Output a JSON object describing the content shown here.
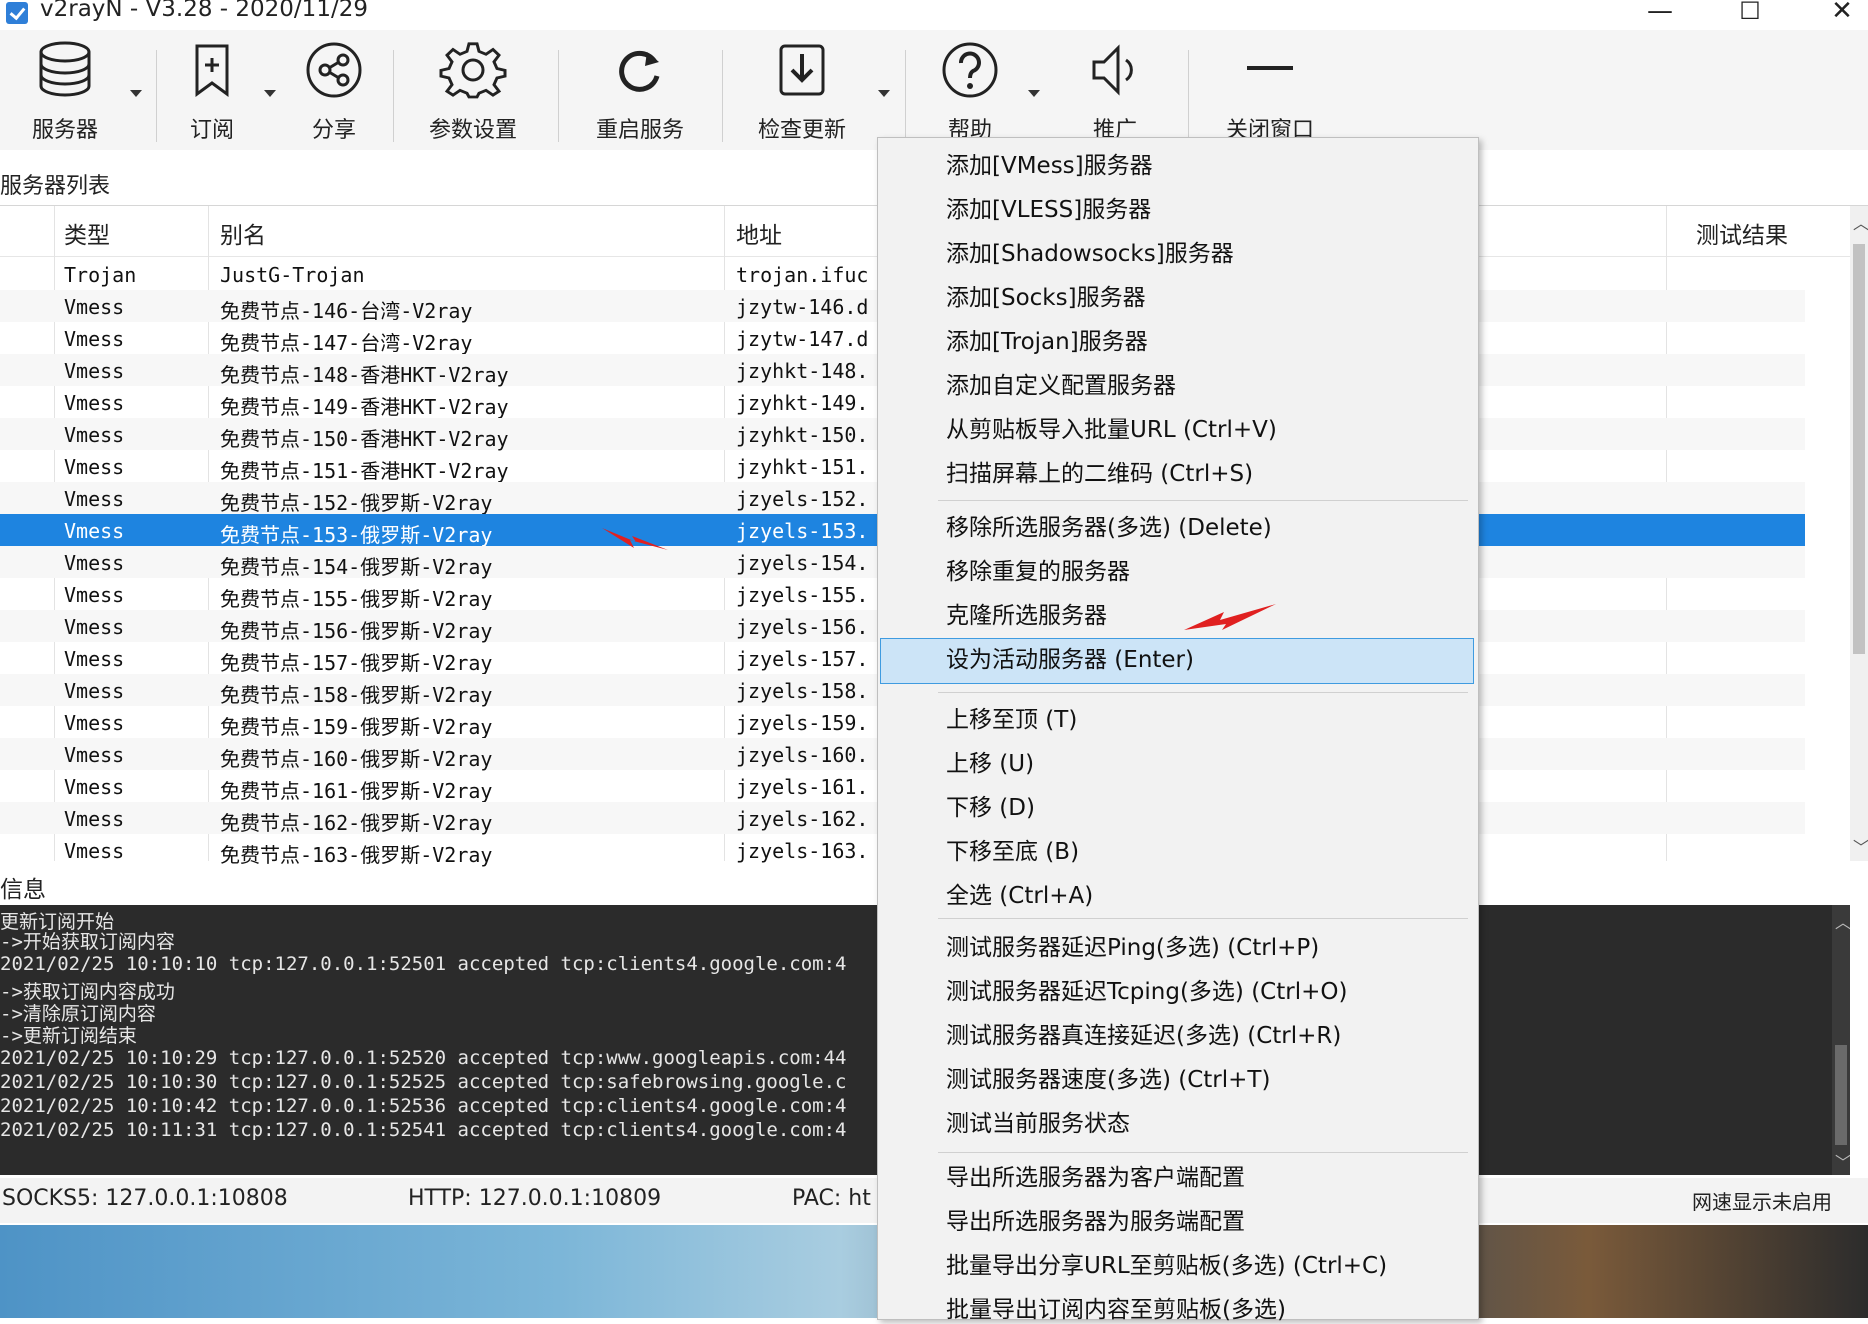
{
  "window": {
    "title": "v2rayN - V3.28 - 2020/11/29",
    "minimize": "—",
    "maximize": "☐",
    "close": "✕"
  },
  "toolbar": {
    "servers": "服务器",
    "subscribe": "订阅",
    "share": "分享",
    "settings": "参数设置",
    "restart": "重启服务",
    "update": "检查更新",
    "help": "帮助",
    "promote": "推广",
    "close_window": "关闭窗口"
  },
  "server_list": {
    "label": "服务器列表",
    "headers": {
      "type": "类型",
      "alias": "别名",
      "address": "地址",
      "test_result": "测试结果"
    },
    "rows": [
      {
        "type": "Trojan",
        "alias": "JustG-Trojan",
        "address": "trojan.ifuc"
      },
      {
        "type": "Vmess",
        "alias": "免费节点-146-台湾-V2ray",
        "address": "jzytw-146.d"
      },
      {
        "type": "Vmess",
        "alias": "免费节点-147-台湾-V2ray",
        "address": "jzytw-147.d"
      },
      {
        "type": "Vmess",
        "alias": "免费节点-148-香港HKT-V2ray",
        "address": "jzyhkt-148."
      },
      {
        "type": "Vmess",
        "alias": "免费节点-149-香港HKT-V2ray",
        "address": "jzyhkt-149."
      },
      {
        "type": "Vmess",
        "alias": "免费节点-150-香港HKT-V2ray",
        "address": "jzyhkt-150."
      },
      {
        "type": "Vmess",
        "alias": "免费节点-151-香港HKT-V2ray",
        "address": "jzyhkt-151."
      },
      {
        "type": "Vmess",
        "alias": "免费节点-152-俄罗斯-V2ray",
        "address": "jzyels-152."
      },
      {
        "type": "Vmess",
        "alias": "免费节点-153-俄罗斯-V2ray",
        "address": "jzyels-153."
      },
      {
        "type": "Vmess",
        "alias": "免费节点-154-俄罗斯-V2ray",
        "address": "jzyels-154."
      },
      {
        "type": "Vmess",
        "alias": "免费节点-155-俄罗斯-V2ray",
        "address": "jzyels-155."
      },
      {
        "type": "Vmess",
        "alias": "免费节点-156-俄罗斯-V2ray",
        "address": "jzyels-156."
      },
      {
        "type": "Vmess",
        "alias": "免费节点-157-俄罗斯-V2ray",
        "address": "jzyels-157."
      },
      {
        "type": "Vmess",
        "alias": "免费节点-158-俄罗斯-V2ray",
        "address": "jzyels-158."
      },
      {
        "type": "Vmess",
        "alias": "免费节点-159-俄罗斯-V2ray",
        "address": "jzyels-159."
      },
      {
        "type": "Vmess",
        "alias": "免费节点-160-俄罗斯-V2ray",
        "address": "jzyels-160."
      },
      {
        "type": "Vmess",
        "alias": "免费节点-161-俄罗斯-V2ray",
        "address": "jzyels-161."
      },
      {
        "type": "Vmess",
        "alias": "免费节点-162-俄罗斯-V2ray",
        "address": "jzyels-162."
      },
      {
        "type": "Vmess",
        "alias": "免费节点-163-俄罗斯-V2ray",
        "address": "jzyels-163."
      }
    ]
  },
  "info": {
    "label": "信息",
    "log": [
      "更新订阅开始",
      "->开始获取订阅内容",
      "2021/02/25 10:10:10 tcp:127.0.0.1:52501 accepted tcp:clients4.google.com:4",
      "->获取订阅内容成功",
      "->清除原订阅内容",
      "->更新订阅结束",
      "2021/02/25 10:10:29 tcp:127.0.0.1:52520 accepted tcp:www.googleapis.com:44",
      "2021/02/25 10:10:30 tcp:127.0.0.1:52525 accepted tcp:safebrowsing.google.c",
      "2021/02/25 10:10:42 tcp:127.0.0.1:52536 accepted tcp:clients4.google.com:4",
      "2021/02/25 10:11:31 tcp:127.0.0.1:52541 accepted tcp:clients4.google.com:4"
    ]
  },
  "status": {
    "socks": "SOCKS5:  127.0.0.1:10808",
    "http": "HTTP:  127.0.0.1:10809",
    "pac": "PAC:  ht",
    "speed": "网速显示未启用"
  },
  "context_menu": {
    "items": [
      "添加[VMess]服务器",
      "添加[VLESS]服务器",
      "添加[Shadowsocks]服务器",
      "添加[Socks]服务器",
      "添加[Trojan]服务器",
      "添加自定义配置服务器",
      "从剪贴板导入批量URL (Ctrl+V)",
      "扫描屏幕上的二维码 (Ctrl+S)",
      "移除所选服务器(多选) (Delete)",
      "移除重复的服务器",
      "克隆所选服务器",
      "设为活动服务器 (Enter)",
      "上移至顶 (T)",
      "上移 (U)",
      "下移 (D)",
      "下移至底 (B)",
      "全选 (Ctrl+A)",
      "测试服务器延迟Ping(多选) (Ctrl+P)",
      "测试服务器延迟Tcping(多选) (Ctrl+O)",
      "测试服务器真连接延迟(多选) (Ctrl+R)",
      "测试服务器速度(多选) (Ctrl+T)",
      "测试当前服务状态",
      "导出所选服务器为客户端配置",
      "导出所选服务器为服务端配置",
      "批量导出分享URL至剪贴板(多选) (Ctrl+C)",
      "批量导出订阅内容至剪贴板(多选)"
    ]
  },
  "colors": {
    "selection": "#1e84e0",
    "menu_highlight": "#cce4f7",
    "log_background": "#2b2b2b",
    "arrow": "#e02020"
  }
}
